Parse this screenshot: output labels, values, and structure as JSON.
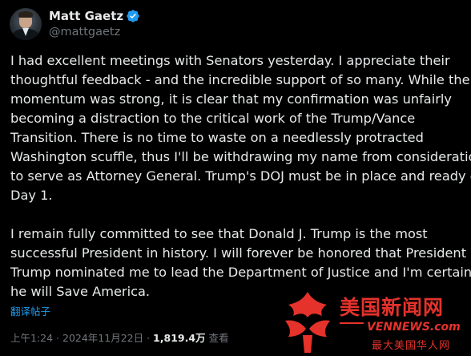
{
  "author": {
    "display_name": "Matt Gaetz",
    "handle": "@mattgaetz",
    "verified": true,
    "verified_color": "#1d9bf0"
  },
  "tweet": {
    "paragraphs": [
      [
        "I had excellent meetings with Senators yesterday.  I appreciate their",
        "thoughtful feedback - and the incredible support of so many.  While the",
        "momentum was strong, it is clear that my confirmation was unfairly",
        "becoming a distraction to the critical work of the Trump/Vance",
        "Transition.  There is no time to waste on a needlessly protracted",
        "Washington scuffle, thus I'll be withdrawing my name from consideration",
        "to serve as Attorney General.  Trump's DOJ must be in place and ready on",
        "Day 1."
      ],
      [
        "I remain fully committed to see that Donald J. Trump is the most",
        "successful President in history.  I will forever be honored that President",
        "Trump nominated me to lead the Department of Justice and I'm certain",
        "he will Save America."
      ]
    ],
    "translate_label": "翻译帖子"
  },
  "meta": {
    "time": "上午1:24",
    "separator": " · ",
    "date": "2024年11月22日",
    "views_count": "1,819.4万",
    "views_label": "查看"
  },
  "watermark": {
    "title": "美国新闻网",
    "url": "VENNEWS.com",
    "slogan": "最大美国华人网",
    "color": "#e5322b"
  },
  "colors": {
    "background": "#000000",
    "text_primary": "#e7e9ea",
    "text_secondary": "#71767b",
    "link": "#1d9bf0"
  }
}
